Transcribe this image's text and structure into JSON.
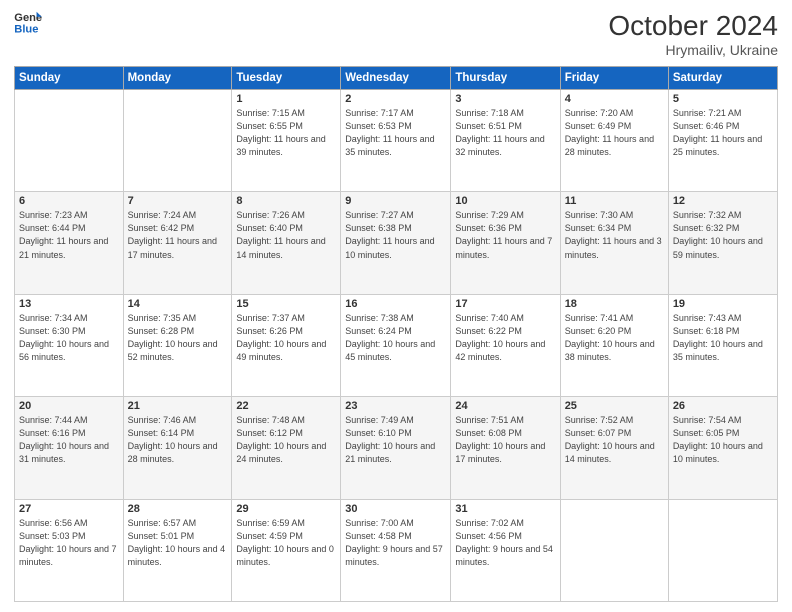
{
  "header": {
    "logo_line1": "General",
    "logo_line2": "Blue",
    "month": "October 2024",
    "location": "Hrymailiv, Ukraine"
  },
  "days_of_week": [
    "Sunday",
    "Monday",
    "Tuesday",
    "Wednesday",
    "Thursday",
    "Friday",
    "Saturday"
  ],
  "weeks": [
    [
      {
        "day": "",
        "detail": ""
      },
      {
        "day": "",
        "detail": ""
      },
      {
        "day": "1",
        "detail": "Sunrise: 7:15 AM\nSunset: 6:55 PM\nDaylight: 11 hours and 39 minutes."
      },
      {
        "day": "2",
        "detail": "Sunrise: 7:17 AM\nSunset: 6:53 PM\nDaylight: 11 hours and 35 minutes."
      },
      {
        "day": "3",
        "detail": "Sunrise: 7:18 AM\nSunset: 6:51 PM\nDaylight: 11 hours and 32 minutes."
      },
      {
        "day": "4",
        "detail": "Sunrise: 7:20 AM\nSunset: 6:49 PM\nDaylight: 11 hours and 28 minutes."
      },
      {
        "day": "5",
        "detail": "Sunrise: 7:21 AM\nSunset: 6:46 PM\nDaylight: 11 hours and 25 minutes."
      }
    ],
    [
      {
        "day": "6",
        "detail": "Sunrise: 7:23 AM\nSunset: 6:44 PM\nDaylight: 11 hours and 21 minutes."
      },
      {
        "day": "7",
        "detail": "Sunrise: 7:24 AM\nSunset: 6:42 PM\nDaylight: 11 hours and 17 minutes."
      },
      {
        "day": "8",
        "detail": "Sunrise: 7:26 AM\nSunset: 6:40 PM\nDaylight: 11 hours and 14 minutes."
      },
      {
        "day": "9",
        "detail": "Sunrise: 7:27 AM\nSunset: 6:38 PM\nDaylight: 11 hours and 10 minutes."
      },
      {
        "day": "10",
        "detail": "Sunrise: 7:29 AM\nSunset: 6:36 PM\nDaylight: 11 hours and 7 minutes."
      },
      {
        "day": "11",
        "detail": "Sunrise: 7:30 AM\nSunset: 6:34 PM\nDaylight: 11 hours and 3 minutes."
      },
      {
        "day": "12",
        "detail": "Sunrise: 7:32 AM\nSunset: 6:32 PM\nDaylight: 10 hours and 59 minutes."
      }
    ],
    [
      {
        "day": "13",
        "detail": "Sunrise: 7:34 AM\nSunset: 6:30 PM\nDaylight: 10 hours and 56 minutes."
      },
      {
        "day": "14",
        "detail": "Sunrise: 7:35 AM\nSunset: 6:28 PM\nDaylight: 10 hours and 52 minutes."
      },
      {
        "day": "15",
        "detail": "Sunrise: 7:37 AM\nSunset: 6:26 PM\nDaylight: 10 hours and 49 minutes."
      },
      {
        "day": "16",
        "detail": "Sunrise: 7:38 AM\nSunset: 6:24 PM\nDaylight: 10 hours and 45 minutes."
      },
      {
        "day": "17",
        "detail": "Sunrise: 7:40 AM\nSunset: 6:22 PM\nDaylight: 10 hours and 42 minutes."
      },
      {
        "day": "18",
        "detail": "Sunrise: 7:41 AM\nSunset: 6:20 PM\nDaylight: 10 hours and 38 minutes."
      },
      {
        "day": "19",
        "detail": "Sunrise: 7:43 AM\nSunset: 6:18 PM\nDaylight: 10 hours and 35 minutes."
      }
    ],
    [
      {
        "day": "20",
        "detail": "Sunrise: 7:44 AM\nSunset: 6:16 PM\nDaylight: 10 hours and 31 minutes."
      },
      {
        "day": "21",
        "detail": "Sunrise: 7:46 AM\nSunset: 6:14 PM\nDaylight: 10 hours and 28 minutes."
      },
      {
        "day": "22",
        "detail": "Sunrise: 7:48 AM\nSunset: 6:12 PM\nDaylight: 10 hours and 24 minutes."
      },
      {
        "day": "23",
        "detail": "Sunrise: 7:49 AM\nSunset: 6:10 PM\nDaylight: 10 hours and 21 minutes."
      },
      {
        "day": "24",
        "detail": "Sunrise: 7:51 AM\nSunset: 6:08 PM\nDaylight: 10 hours and 17 minutes."
      },
      {
        "day": "25",
        "detail": "Sunrise: 7:52 AM\nSunset: 6:07 PM\nDaylight: 10 hours and 14 minutes."
      },
      {
        "day": "26",
        "detail": "Sunrise: 7:54 AM\nSunset: 6:05 PM\nDaylight: 10 hours and 10 minutes."
      }
    ],
    [
      {
        "day": "27",
        "detail": "Sunrise: 6:56 AM\nSunset: 5:03 PM\nDaylight: 10 hours and 7 minutes."
      },
      {
        "day": "28",
        "detail": "Sunrise: 6:57 AM\nSunset: 5:01 PM\nDaylight: 10 hours and 4 minutes."
      },
      {
        "day": "29",
        "detail": "Sunrise: 6:59 AM\nSunset: 4:59 PM\nDaylight: 10 hours and 0 minutes."
      },
      {
        "day": "30",
        "detail": "Sunrise: 7:00 AM\nSunset: 4:58 PM\nDaylight: 9 hours and 57 minutes."
      },
      {
        "day": "31",
        "detail": "Sunrise: 7:02 AM\nSunset: 4:56 PM\nDaylight: 9 hours and 54 minutes."
      },
      {
        "day": "",
        "detail": ""
      },
      {
        "day": "",
        "detail": ""
      }
    ]
  ]
}
